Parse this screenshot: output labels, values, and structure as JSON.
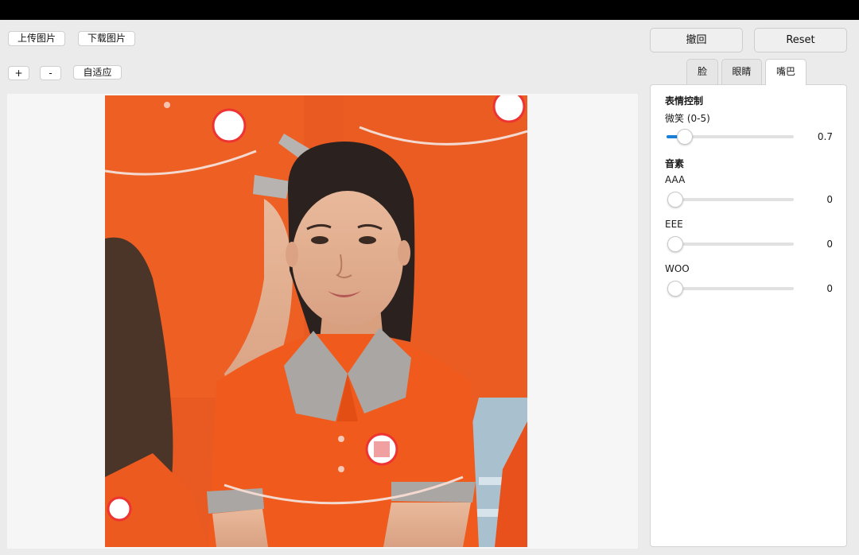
{
  "toolbar": {
    "upload_label": "上传图片",
    "download_label": "下载图片",
    "zoom_in_label": "+",
    "zoom_out_label": "-",
    "fit_label": "自适应"
  },
  "actions": {
    "undo_label": "撤回",
    "reset_label": "Reset"
  },
  "tabs": [
    {
      "label": "脸",
      "active": false
    },
    {
      "label": "眼睛",
      "active": false
    },
    {
      "label": "嘴巴",
      "active": true
    }
  ],
  "panel": {
    "expression_title": "表情控制",
    "smile": {
      "label": "微笑 (0-5)",
      "value": "0.7",
      "fraction": 0.14
    },
    "phoneme_title": "音素",
    "sliders": [
      {
        "label": "AAA",
        "value": "0",
        "fraction": 0
      },
      {
        "label": "EEE",
        "value": "0",
        "fraction": 0
      },
      {
        "label": "WOO",
        "value": "0",
        "fraction": 0
      }
    ]
  },
  "colors": {
    "accent": "#1a7fd6",
    "uniform": "#f05a1c"
  }
}
